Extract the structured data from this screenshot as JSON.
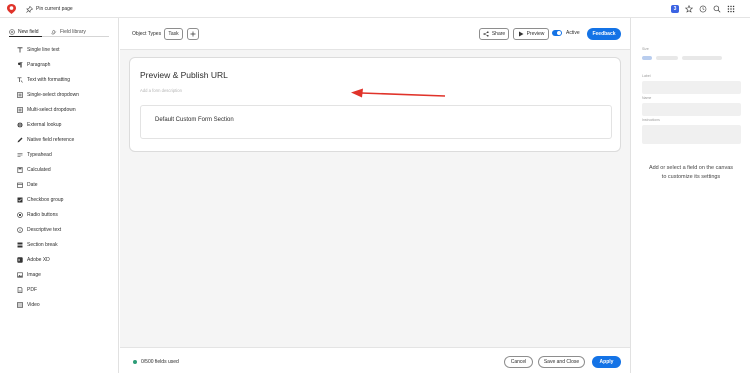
{
  "topbar": {
    "pin_label": "Pin current page",
    "notification_count": "3",
    "brand_color": "#e0332a"
  },
  "left_panel": {
    "tabs": [
      {
        "label": "New field",
        "icon": "add-circle-icon",
        "active": true
      },
      {
        "label": "Field library",
        "icon": "library-icon",
        "active": false
      }
    ],
    "fields": [
      {
        "label": "Single line text",
        "icon": "text-t-icon"
      },
      {
        "label": "Paragraph",
        "icon": "paragraph-icon"
      },
      {
        "label": "Text with formatting",
        "icon": "text-format-icon"
      },
      {
        "label": "Single-select dropdown",
        "icon": "single-select-icon"
      },
      {
        "label": "Multi-select dropdown",
        "icon": "multi-select-icon"
      },
      {
        "label": "External lookup",
        "icon": "external-lookup-icon"
      },
      {
        "label": "Native field reference",
        "icon": "pen-icon"
      },
      {
        "label": "Typeahead",
        "icon": "typeahead-icon"
      },
      {
        "label": "Calculated",
        "icon": "calculator-icon"
      },
      {
        "label": "Date",
        "icon": "calendar-icon"
      },
      {
        "label": "Checkbox group",
        "icon": "checkbox-icon"
      },
      {
        "label": "Radio buttons",
        "icon": "radio-icon"
      },
      {
        "label": "Descriptive text",
        "icon": "info-icon"
      },
      {
        "label": "Section break",
        "icon": "section-break-icon"
      },
      {
        "label": "Adobe XD",
        "icon": "xd-icon"
      },
      {
        "label": "Image",
        "icon": "image-icon"
      },
      {
        "label": "PDF",
        "icon": "pdf-icon"
      },
      {
        "label": "Video",
        "icon": "video-icon"
      }
    ]
  },
  "toolbar": {
    "object_types_label": "Object Types",
    "task_chip": "Task",
    "share_label": "Share",
    "preview_label": "Preview",
    "active_label": "Active",
    "active_on": true,
    "feedback_label": "Feedback",
    "accent_color": "#1473e6"
  },
  "form": {
    "title": "Preview & Publish URL",
    "description_placeholder": "Add a form description",
    "section_title": "Default Custom Form Section",
    "annotation_color": "#e0332a"
  },
  "footer": {
    "status_text": "0/500 fields used",
    "status_color": "#2d9d78",
    "cancel_label": "Cancel",
    "save_close_label": "Save and Close",
    "apply_label": "Apply"
  },
  "right_panel": {
    "size_label": "Size",
    "label_label": "Label",
    "name_label": "Name",
    "instructions_label": "Instructions",
    "hint": "Add or select a field on the canvas to customize its settings"
  }
}
